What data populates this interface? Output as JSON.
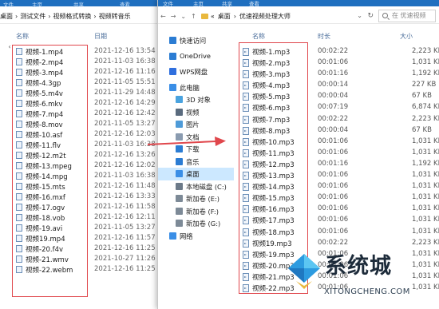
{
  "left_window": {
    "ribbon": [
      "文件",
      "主页",
      "共享",
      "查看"
    ],
    "nav_buttons": "‹",
    "breadcrumb": [
      "桌面",
      "测试文件",
      "视频格式转换",
      "视频转音乐"
    ],
    "col_name": "名称",
    "col_date": "日期",
    "files": [
      {
        "name": "视频-1.mp4",
        "date": "2021-12-16 13:54"
      },
      {
        "name": "视频-2.mp4",
        "date": "2021-11-03 16:38"
      },
      {
        "name": "视频-3.mp4",
        "date": "2021-12-16 11:16"
      },
      {
        "name": "视频-4.3gp",
        "date": "2021-11-05 15:51"
      },
      {
        "name": "视频-5.m4v",
        "date": "2021-11-29 14:48"
      },
      {
        "name": "视频-6.mkv",
        "date": "2021-12-16 14:29"
      },
      {
        "name": "视频-7.mp4",
        "date": "2021-12-16 12:42"
      },
      {
        "name": "视频-8.mov",
        "date": "2021-11-05 13:27"
      },
      {
        "name": "视频-10.asf",
        "date": "2021-12-16 12:03"
      },
      {
        "name": "视频-11.flv",
        "date": "2021-11-03 16:38"
      },
      {
        "name": "视频-12.m2t",
        "date": "2021-12-16 13:26"
      },
      {
        "name": "视频-13.mpeg",
        "date": "2021-12-16 12:02"
      },
      {
        "name": "视频-14.mpg",
        "date": "2021-11-03 16:38"
      },
      {
        "name": "视频-15.mts",
        "date": "2021-12-16 11:48"
      },
      {
        "name": "视频-16.mxf",
        "date": "2021-12-16 13:33"
      },
      {
        "name": "视频-17.ogv",
        "date": "2021-12-16 11:58"
      },
      {
        "name": "视频-18.vob",
        "date": "2021-12-16 12:11"
      },
      {
        "name": "视频-19.avi",
        "date": "2021-11-05 13:27"
      },
      {
        "name": "视频19.mp4",
        "date": "2021-12-16 11:57"
      },
      {
        "name": "视频-20.f4v",
        "date": "2021-12-16 11:25"
      },
      {
        "name": "视频-21.wmv",
        "date": "2021-10-27 11:26"
      },
      {
        "name": "视频-22.webm",
        "date": "2021-12-16 11:25"
      }
    ]
  },
  "right_window": {
    "ribbon": [
      "文件",
      "主页",
      "共享",
      "查看"
    ],
    "breadcrumb": [
      "桌面",
      "优速视频处理大师"
    ],
    "search_placeholder": "在 优速视频",
    "col_name": "名称",
    "col_duration": "时长",
    "col_size": "大小",
    "nav": [
      {
        "label": "快速访问",
        "icon": "star-icon",
        "color": "#2b7cd3"
      },
      {
        "label": "OneDrive",
        "icon": "cloud-icon",
        "color": "#2b7cd3"
      },
      {
        "label": "WPS网盘",
        "icon": "wps-cloud-icon",
        "color": "#2f6fde"
      },
      {
        "label": "此电脑",
        "icon": "pc-icon",
        "color": "#3a8ee6"
      },
      {
        "label": "3D 对象",
        "icon": "cube-icon",
        "color": "#4aa3df"
      },
      {
        "label": "视频",
        "icon": "video-icon",
        "color": "#5a6b7e"
      },
      {
        "label": "图片",
        "icon": "picture-icon",
        "color": "#4e9bd8"
      },
      {
        "label": "文档",
        "icon": "document-icon",
        "color": "#8a9bb0"
      },
      {
        "label": "下载",
        "icon": "download-icon",
        "color": "#2b7cd3"
      },
      {
        "label": "音乐",
        "icon": "music-icon",
        "color": "#2b7cd3"
      },
      {
        "label": "桌面",
        "icon": "desktop-icon",
        "color": "#3a8ee6"
      },
      {
        "label": "本地磁盘 (C:)",
        "icon": "drive-c-icon",
        "color": "#6c7a89"
      },
      {
        "label": "新加卷 (E:)",
        "icon": "drive-icon",
        "color": "#7d8a97"
      },
      {
        "label": "新加卷 (F:)",
        "icon": "drive-icon",
        "color": "#7d8a97"
      },
      {
        "label": "新加卷 (G:)",
        "icon": "drive-icon",
        "color": "#7d8a97"
      },
      {
        "label": "网络",
        "icon": "network-icon",
        "color": "#3a8ee6"
      }
    ],
    "files": [
      {
        "name": "视频-1.mp3",
        "duration": "00:02:22",
        "size": "2,223 KB"
      },
      {
        "name": "视频-2.mp3",
        "duration": "00:01:06",
        "size": "1,031 KB"
      },
      {
        "name": "视频-3.mp3",
        "duration": "00:01:16",
        "size": "1,192 KB"
      },
      {
        "name": "视频-4.mp3",
        "duration": "00:00:14",
        "size": "227 KB"
      },
      {
        "name": "视频-5.mp3",
        "duration": "00:00:04",
        "size": "67 KB"
      },
      {
        "name": "视频-6.mp3",
        "duration": "00:07:19",
        "size": "6,874 KB"
      },
      {
        "name": "视频-7.mp3",
        "duration": "00:02:22",
        "size": "2,223 KB"
      },
      {
        "name": "视频-8.mp3",
        "duration": "00:00:04",
        "size": "67 KB"
      },
      {
        "name": "视频-10.mp3",
        "duration": "00:01:06",
        "size": "1,031 KB"
      },
      {
        "name": "视频-11.mp3",
        "duration": "00:01:06",
        "size": "1,031 KB"
      },
      {
        "name": "视频-12.mp3",
        "duration": "00:01:16",
        "size": "1,192 KB"
      },
      {
        "name": "视频-13.mp3",
        "duration": "00:01:06",
        "size": "1,031 KB"
      },
      {
        "name": "视频-14.mp3",
        "duration": "00:01:06",
        "size": "1,031 KB"
      },
      {
        "name": "视频-15.mp3",
        "duration": "00:01:06",
        "size": "1,031 KB"
      },
      {
        "name": "视频-16.mp3",
        "duration": "00:01:06",
        "size": "1,031 KB"
      },
      {
        "name": "视频-17.mp3",
        "duration": "00:01:06",
        "size": "1,031 KB"
      },
      {
        "name": "视频-18.mp3",
        "duration": "00:01:06",
        "size": "1,031 KB"
      },
      {
        "name": "视频19.mp3",
        "duration": "00:02:22",
        "size": "2,223 KB"
      },
      {
        "name": "视频-19.mp3",
        "duration": "00:01:06",
        "size": "1,031 KB"
      },
      {
        "name": "视频-20.mp3",
        "duration": "00:01:06",
        "size": "1,031 KB"
      },
      {
        "name": "视频-21.mp3",
        "duration": "00:01:06",
        "size": "1,031 KB"
      },
      {
        "name": "视频-22.mp3",
        "duration": "00:01:06",
        "size": "1,031 KB"
      }
    ]
  },
  "watermark": {
    "name": "系统城",
    "url": "XITONGCHENG.COM"
  },
  "colors": {
    "highlight_box": "#e0474c",
    "ribbon": "#1f6fbf",
    "selected_nav": "#cce8ff"
  }
}
